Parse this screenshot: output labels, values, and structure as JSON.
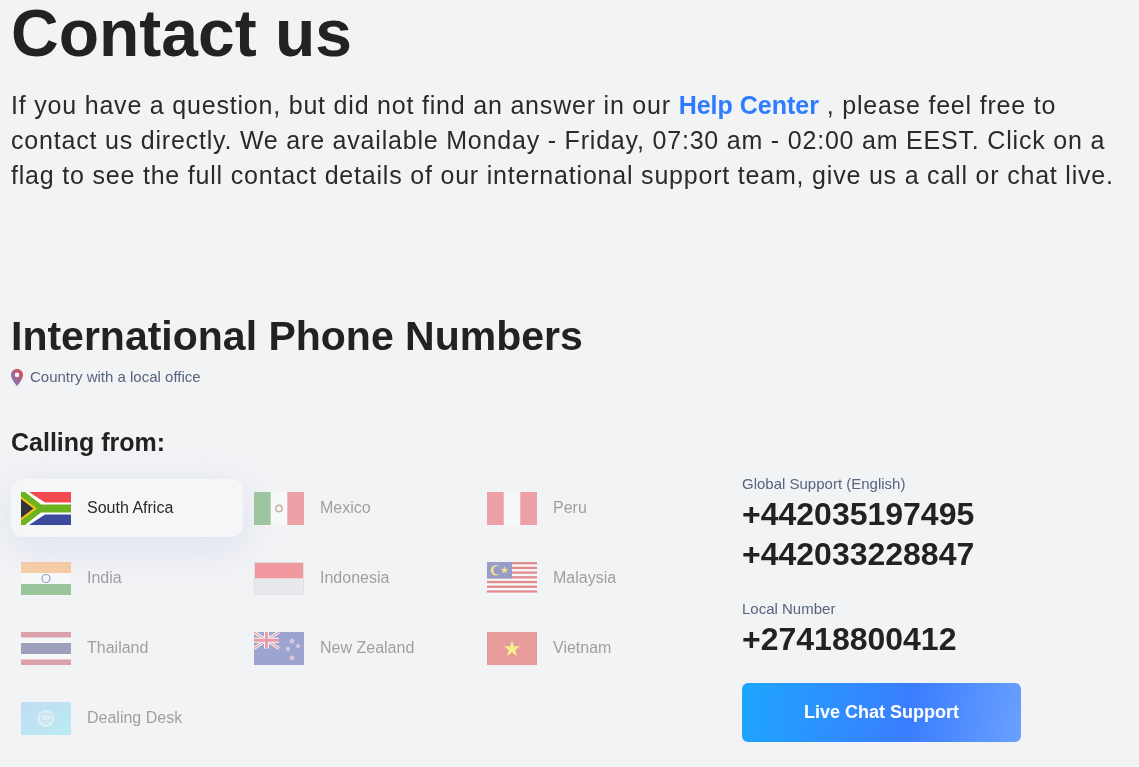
{
  "title": "Contact us",
  "intro": {
    "before": "If you have a question, but did not find an answer in our",
    "link": "Help Center",
    "after": ", please feel free to contact us directly. We are available Monday - Friday, 07:30 am - 02:00 am EEST. Click on a flag to see the full contact details of our international support team, give us a call or chat live."
  },
  "phone": {
    "heading": "International Phone Numbers",
    "legend": "Country with a local office",
    "calling_from": "Calling from:",
    "countries": [
      {
        "name": "South Africa",
        "selected": true,
        "kind": "flag"
      },
      {
        "name": "Mexico",
        "selected": false,
        "kind": "flag"
      },
      {
        "name": "Peru",
        "selected": false,
        "kind": "flag"
      },
      {
        "name": "India",
        "selected": false,
        "kind": "flag"
      },
      {
        "name": "Indonesia",
        "selected": false,
        "kind": "flag"
      },
      {
        "name": "Malaysia",
        "selected": false,
        "kind": "flag"
      },
      {
        "name": "Thailand",
        "selected": false,
        "kind": "flag"
      },
      {
        "name": "New Zealand",
        "selected": false,
        "kind": "flag"
      },
      {
        "name": "Vietnam",
        "selected": false,
        "kind": "flag"
      },
      {
        "name": "Dealing Desk",
        "selected": false,
        "kind": "desk"
      }
    ],
    "support": {
      "groups": [
        {
          "label": "Global Support (English)",
          "numbers": [
            "+442035197495",
            "+442033228847"
          ]
        },
        {
          "label": "Local Number",
          "numbers": [
            "+27418800412"
          ]
        }
      ],
      "button": "Live Chat Support"
    }
  }
}
